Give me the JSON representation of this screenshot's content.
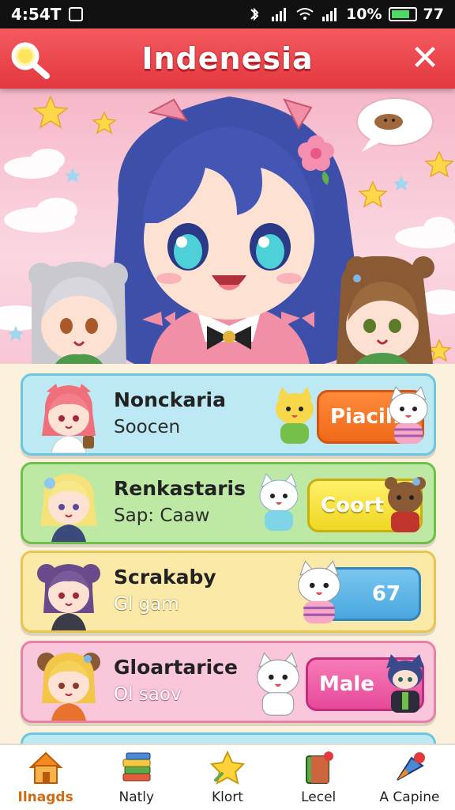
{
  "status_bar": {
    "time": "4:54T",
    "battery": "10%",
    "extra": "77"
  },
  "header": {
    "title": "Indenesia"
  },
  "list": [
    {
      "name": "Nonckaria",
      "sub": "Soocen",
      "action": "Piacih",
      "color": "#bde9f4"
    },
    {
      "name": "Renkastaris",
      "sub": "Sap: Caaw",
      "action": "Coort",
      "color": "#bde9a4"
    },
    {
      "name": "Scrakaby",
      "sub": "Gl gam",
      "action": "67",
      "color": "#fbe9a8"
    },
    {
      "name": "Gloartarice",
      "sub": "Ol saov",
      "action": "Male",
      "color": "#f9c6dc"
    }
  ],
  "bottom_nav": [
    {
      "label": "Ilnagds",
      "icon": "home-icon"
    },
    {
      "label": "Natly",
      "icon": "books-icon"
    },
    {
      "label": "Klort",
      "icon": "star-icon"
    },
    {
      "label": "Lecel",
      "icon": "book-icon"
    },
    {
      "label": "A Capine",
      "icon": "pin-icon"
    }
  ]
}
